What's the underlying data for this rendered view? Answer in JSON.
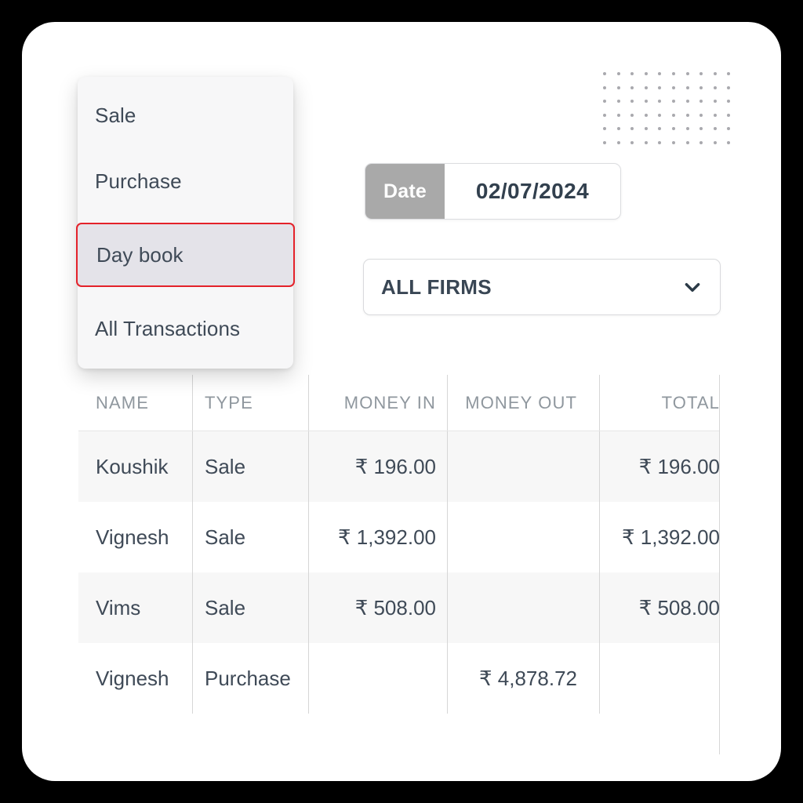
{
  "menu": {
    "items": [
      {
        "label": "Sale",
        "selected": false
      },
      {
        "label": "Purchase",
        "selected": false
      },
      {
        "label": "Day book",
        "selected": true
      },
      {
        "label": "All Transactions",
        "selected": false
      }
    ],
    "selected_accent_color": "#e4222a",
    "selected_background_color": "#e4e3e9"
  },
  "date_control": {
    "label": "Date",
    "value": "02/07/2024",
    "label_background_color": "#a9a9a9"
  },
  "firm_select": {
    "value": "ALL FIRMS",
    "icon": "chevron-down-icon"
  },
  "table": {
    "columns": [
      "NAME",
      "TYPE",
      "MONEY IN",
      "MONEY OUT",
      "TOTAL"
    ],
    "rows": [
      {
        "name": "Koushik",
        "type": "Sale",
        "money_in": "₹ 196.00",
        "money_out": "",
        "total": "₹ 196.00"
      },
      {
        "name": "Vignesh",
        "type": "Sale",
        "money_in": "₹ 1,392.00",
        "money_out": "",
        "total": "₹ 1,392.00"
      },
      {
        "name": "Vims",
        "type": "Sale",
        "money_in": "₹ 508.00",
        "money_out": "",
        "total": "₹ 508.00"
      },
      {
        "name": "Vignesh",
        "type": "Purchase",
        "money_in": "",
        "money_out": "₹ 4,878.72",
        "total": ""
      }
    ]
  },
  "decoration": {
    "dot_grid": {
      "columns": 10,
      "rows": 6,
      "color": "#a9a9ae"
    }
  }
}
